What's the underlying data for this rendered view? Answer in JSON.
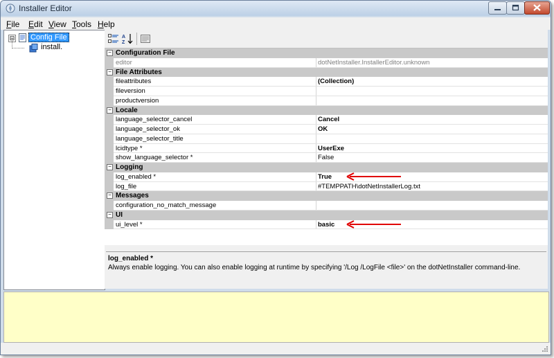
{
  "window": {
    "title": "Installer Editor",
    "colors": {
      "selection": "#3399ff",
      "output_background": "#ffffc8",
      "arrow": "#e00000"
    }
  },
  "menu": [
    {
      "key": "F",
      "rest": "ile"
    },
    {
      "key": "E",
      "rest": "dit"
    },
    {
      "key": "V",
      "rest": "iew"
    },
    {
      "key": "T",
      "rest": "ools"
    },
    {
      "key": "H",
      "rest": "elp"
    }
  ],
  "tree": {
    "expander": "⊟",
    "root": {
      "label": "Config File",
      "icon": "config-file-icon"
    },
    "child": {
      "label": "install.",
      "icon": "installer-icon"
    }
  },
  "toolbar": {
    "categorized_icon": "categorized-icon",
    "alphabetical_icon": "alphabetical-icon",
    "property_pages_icon": "property-pages-icon"
  },
  "grid": {
    "collapse_glyph": "−",
    "rows": [
      {
        "type": "cat",
        "name": "Configuration File"
      },
      {
        "type": "prop",
        "name": "editor",
        "value": "dotNetInstaller.InstallerEditor.unknown",
        "readonly": true
      },
      {
        "type": "cat",
        "name": "File Attributes"
      },
      {
        "type": "prop",
        "name": "fileattributes",
        "value": "(Collection)",
        "bold": true
      },
      {
        "type": "prop",
        "name": "fileversion",
        "value": ""
      },
      {
        "type": "prop",
        "name": "productversion",
        "value": ""
      },
      {
        "type": "cat",
        "name": "Locale"
      },
      {
        "type": "prop",
        "name": "language_selector_cancel",
        "value": "Cancel",
        "bold": true
      },
      {
        "type": "prop",
        "name": "language_selector_ok",
        "value": "OK",
        "bold": true
      },
      {
        "type": "prop",
        "name": "language_selector_title",
        "value": ""
      },
      {
        "type": "prop",
        "name": "lcidtype *",
        "value": "UserExe",
        "bold": true
      },
      {
        "type": "prop",
        "name": "show_language_selector *",
        "value": "False"
      },
      {
        "type": "cat",
        "name": "Logging"
      },
      {
        "type": "prop",
        "name": "log_enabled *",
        "value": "True",
        "bold": true,
        "arrow": true
      },
      {
        "type": "prop",
        "name": "log_file",
        "value": "#TEMPPATH\\dotNetInstallerLog.txt"
      },
      {
        "type": "cat",
        "name": "Messages"
      },
      {
        "type": "prop",
        "name": "configuration_no_match_message",
        "value": ""
      },
      {
        "type": "cat",
        "name": "UI"
      },
      {
        "type": "prop",
        "name": "ui_level *",
        "value": "basic",
        "bold": true,
        "arrow": true
      }
    ]
  },
  "description": {
    "title": "log_enabled *",
    "text": "Always enable logging. You can also enable logging at runtime by specifying '/Log /LogFile <file>' on the dotNetInstaller command-line."
  },
  "output": {
    "text": ""
  }
}
